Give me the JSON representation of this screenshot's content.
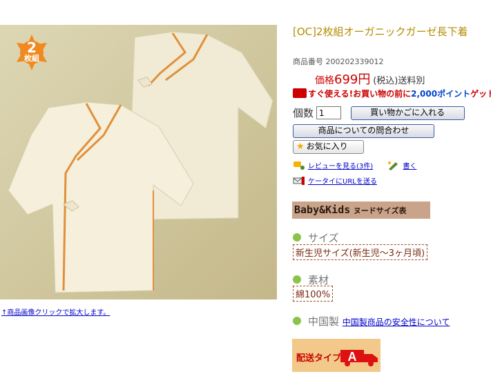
{
  "product": {
    "title": "[OC]2枚組オーガニックガーゼ長下着",
    "code_label": "商品番号",
    "code": "200202339012",
    "price_label": "価格",
    "price": "699円",
    "tax_note": "(税込)",
    "shipping_note": "送料別",
    "point_text": "すぐ使える!お買い物の前に",
    "point_amount": "2,000ポイント",
    "point_suffix": "ゲット"
  },
  "photo": {
    "badge_number": "2",
    "badge_label": "枚組",
    "zoom_link": "↑商品画像クリックで拡大します。"
  },
  "cart": {
    "qty_label": "個数",
    "qty_value": "1",
    "add_to_cart": "買い物かごに入れる",
    "inquiry": "商品についての問合わせ",
    "favorite": "お気に入り"
  },
  "links": {
    "reviews": "レビューを見る(3件)",
    "write": "書く",
    "mobile_url": "ケータイにURLを送る"
  },
  "size_table": {
    "brand": "Baby&Kids",
    "label": "ヌードサイズ表"
  },
  "specs": {
    "size_heading": "サイズ",
    "size_value": "新生児サイズ(新生児～3ヶ月頃)",
    "material_heading": "素材",
    "material_value": "綿100%",
    "origin_heading": "中国製",
    "origin_link": "中国製商品の安全性について"
  },
  "shipping": {
    "label": "配送タイプ",
    "type": "A"
  },
  "colors": {
    "title": "#b58c00",
    "price": "#cc0000",
    "link": "#0000cc",
    "badge": "#f08a20",
    "bullet": "#8bc34a"
  }
}
